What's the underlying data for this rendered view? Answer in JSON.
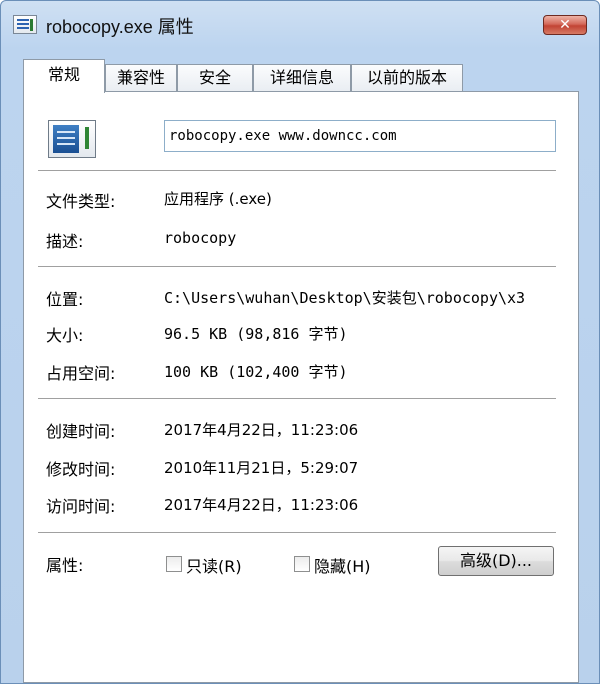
{
  "window": {
    "title": "robocopy.exe 属性"
  },
  "title_buttons": {
    "close": "✕"
  },
  "tabs": [
    {
      "label": "常规",
      "active": true
    },
    {
      "label": "兼容性",
      "active": false
    },
    {
      "label": "安全",
      "active": false
    },
    {
      "label": "详细信息",
      "active": false
    },
    {
      "label": "以前的版本",
      "active": false
    }
  ],
  "general": {
    "file_name": "robocopy.exe   www.downcc.com",
    "fields": {
      "file_type": {
        "label": "文件类型:",
        "value": "应用程序 (.exe)"
      },
      "description": {
        "label": "描述:",
        "value": "robocopy"
      },
      "location": {
        "label": "位置:",
        "value": "C:\\Users\\wuhan\\Desktop\\安装包\\robocopy\\x3"
      },
      "size": {
        "label": "大小:",
        "value": "96.5 KB (98,816 字节)"
      },
      "size_on_disk": {
        "label": "占用空间:",
        "value": "100 KB (102,400 字节)"
      },
      "created": {
        "label": "创建时间:",
        "value": "2017年4月22日，11:23:06"
      },
      "modified": {
        "label": "修改时间:",
        "value": "2010年11月21日，5:29:07"
      },
      "accessed": {
        "label": "访问时间:",
        "value": "2017年4月22日，11:23:06"
      }
    },
    "attributes": {
      "label": "属性:",
      "readonly": {
        "label": "只读(R)",
        "checked": false
      },
      "hidden": {
        "label": "隐藏(H)",
        "checked": false
      },
      "advanced_button": "高级(D)..."
    }
  },
  "icons": {
    "file_icon": "application-exe-icon"
  },
  "colors": {
    "title_bg": "#bcd4ef",
    "close_button": "#c24434",
    "panel_bg": "#ffffff"
  }
}
